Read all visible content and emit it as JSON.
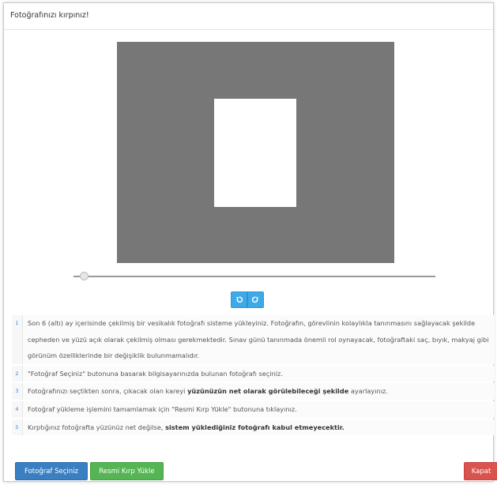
{
  "header": {
    "title": "Fotoğrafınızı kırpınız!"
  },
  "icons": {
    "rotate_left": "rotate-left-icon",
    "rotate_right": "rotate-right-icon"
  },
  "colors": {
    "crop_background": "#777777",
    "primary": "#3a7fc1",
    "success": "#55b453",
    "danger": "#d9534f",
    "rotate": "#3fa9e8"
  },
  "zoom_slider": {
    "value_percent": 2
  },
  "instructions": [
    {
      "num": "1",
      "text": "Son 6 (altı) ay içerisinde çekilmiş bir vesikalık fotoğrafı sisteme yükleyiniz. Fotoğrafın, görevlinin kolaylıkla tanınmasını sağlayacak şekilde cepheden ve yüzü açık olarak çekilmiş olması gerekmektedir. Sınav günü tanınmada önemli rol oynayacak, fotoğraftaki saç, bıyık, makyaj gibi görünüm özelliklerinde bir değişiklik bulunmamalıdır."
    },
    {
      "num": "2",
      "text": "\"Fotoğraf Seçiniz\" butonuna basarak bilgisayarınızda bulunan fotoğrafı seçiniz."
    },
    {
      "num": "3",
      "text_before": "Fotoğrafınızı seçtikten sonra, çıkacak olan kareyi ",
      "bold": "yüzünüzün net olarak görülebileceği şekilde",
      "text_after": " ayarlayınız."
    },
    {
      "num": "4",
      "text": "Fotoğraf yükleme işlemini tamamlamak için \"Resmi Kırp Yükle\" butonuna tıklayınız."
    },
    {
      "num": "5",
      "text_before": "Kırptığınız fotoğrafta yüzünüz net değilse, ",
      "bold": "sistem yüklediğiniz fotoğrafı kabul etmeyecektir.",
      "text_after": ""
    }
  ],
  "buttons": {
    "select": "Fotoğraf Seçiniz",
    "crop_upload": "Resmi Kırp Yükle",
    "close": "Kapat"
  }
}
